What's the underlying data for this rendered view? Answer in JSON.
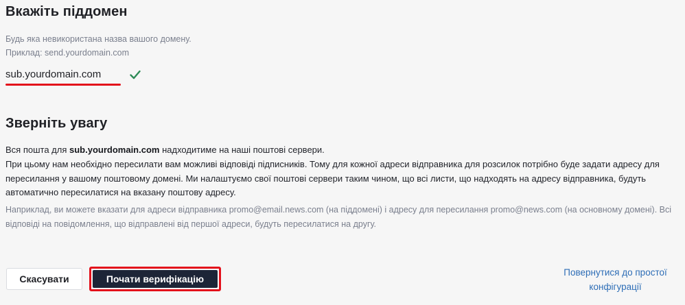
{
  "subdomain_section": {
    "title": "Вкажіть піддомен",
    "hint_line1": "Будь яка невикористана назва вашого домену.",
    "hint_line2": "Приклад: send.yourdomain.com",
    "value": "sub.yourdomain.com",
    "valid_icon": "check-icon",
    "valid_color": "#2e8b57",
    "underline_color": "#e3101b"
  },
  "notice_section": {
    "title": "Зверніть увагу",
    "line1_prefix": "Вся пошта для ",
    "line1_domain": "sub.yourdomain.com",
    "line1_suffix": " надходитиме на наші поштові сервери.",
    "paragraph": "При цьому нам необхідно пересилати вам можливі відповіді підписників. Тому для кожної адреси відправника для розсилок потрібно буде задати адресу для пересилання у вашому поштовому домені. Ми налаштуємо свої поштові сервери таким чином, що всі листи, що надходять на адресу відправника, будуть автоматично пересилатися на вказану поштову адресу.",
    "example": "Наприклад, ви можете вказати для адреси відправника promo@email.news.com (на піддомені) і адресу для пересилання promo@news.com (на основному домені). Всі відповіді на повідомлення, що відправлені від першої адреси, будуть пересилатися на другу."
  },
  "actions": {
    "cancel_label": "Скасувати",
    "verify_label": "Почати верифікацію",
    "back_link": "Повернутися до простої конфігурації",
    "verify_bg": "#1d2537",
    "highlight_color": "#e3101b",
    "link_color": "#2d6db6"
  }
}
